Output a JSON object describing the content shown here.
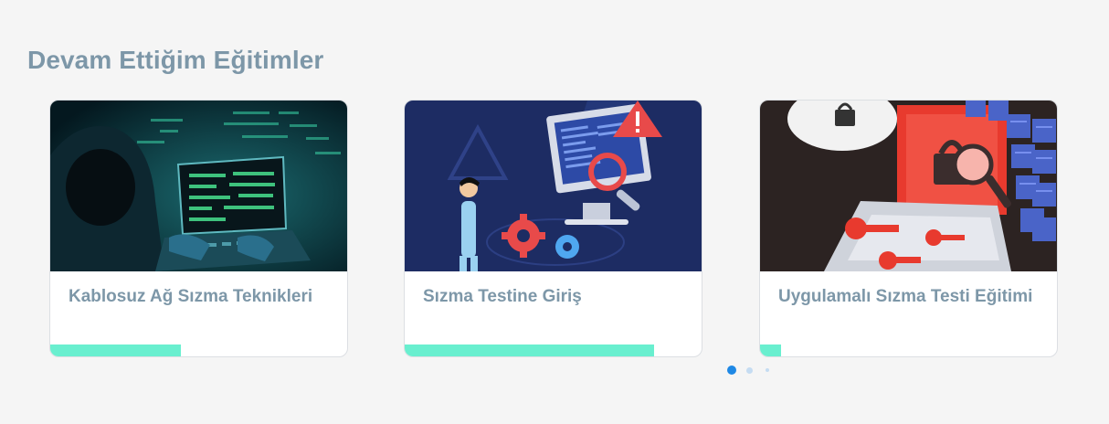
{
  "section": {
    "title": "Devam Ettiğim Eğitimler"
  },
  "courses": [
    {
      "title": "Kablosuz Ağ Sızma Teknikleri",
      "progress": 0.44,
      "image_icon": "hacker-laptop-illustration"
    },
    {
      "title": "Sızma Testine Giriş",
      "progress": 0.84,
      "image_icon": "pentest-monitor-illustration"
    },
    {
      "title": "Uygulamalı Sızma Testi Eğitimi",
      "progress": 0.07,
      "image_icon": "security-keys-illustration"
    }
  ],
  "pagination": {
    "active_index": 0,
    "count": 3
  },
  "colors": {
    "background": "#f5f5f5",
    "title": "#7d97a8",
    "progress": "#69efcf",
    "dot_active": "#1e88e5",
    "dot_inactive": "#c5dcf2"
  }
}
